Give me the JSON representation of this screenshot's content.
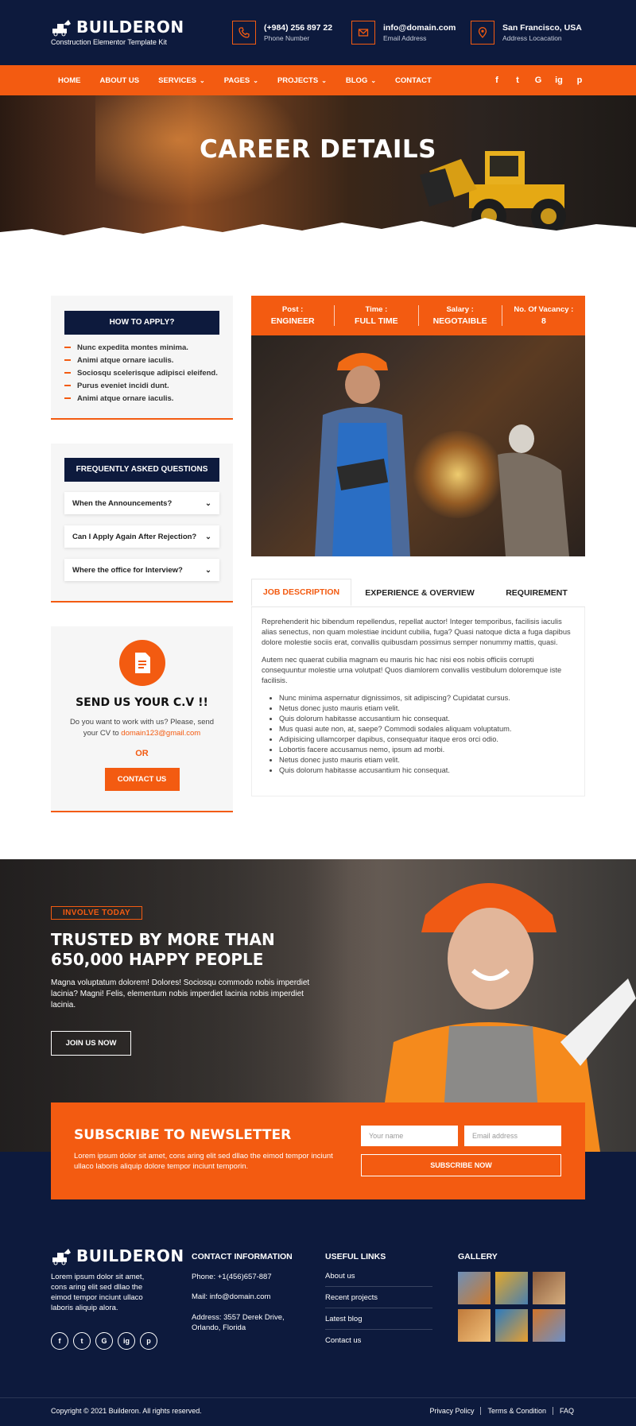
{
  "header": {
    "logo_name": "BUILDERON",
    "logo_tagline": "Construction Elementor Template Kit",
    "contacts": [
      {
        "icon": "phone-icon",
        "value": "(+984) 256 897 22",
        "label": "Phone Number"
      },
      {
        "icon": "mail-icon",
        "value": "info@domain.com",
        "label": "Email Address"
      },
      {
        "icon": "map-pin-icon",
        "value": "San Francisco, USA",
        "label": "Address Locacation"
      }
    ]
  },
  "nav": {
    "items": [
      "HOME",
      "ABOUT US",
      "SERVICES",
      "PAGES",
      "PROJECTS",
      "BLOG",
      "CONTACT"
    ],
    "social": [
      "f",
      "t",
      "G",
      "ig",
      "p"
    ]
  },
  "hero": {
    "title": "CAREER DETAILS"
  },
  "sidebar": {
    "apply_title": "HOW TO APPLY?",
    "apply_items": [
      "Nunc expedita montes minima.",
      "Animi atque ornare iaculis.",
      "Sociosqu scelerisque adipisci eleifend.",
      "Purus eveniet incidi dunt.",
      "Animi atque ornare iaculis."
    ],
    "faq_title": "FREQUENTLY ASKED QUESTIONS",
    "faq_items": [
      "When the Announcements?",
      "Can I Apply Again After Rejection?",
      "Where the office for Interview?"
    ],
    "cv_title": "SEND US YOUR C.V !!",
    "cv_text": "Do you want to work with us? Please, send your CV to",
    "cv_email": "domain123@gmail.com",
    "cv_or": "OR",
    "cv_button": "CONTACT US"
  },
  "job": {
    "meta": [
      {
        "label": "Post :",
        "value": "ENGINEER"
      },
      {
        "label": "Time :",
        "value": "FULL TIME"
      },
      {
        "label": "Salary :",
        "value": "NEGOTAIBLE"
      },
      {
        "label": "No. Of Vacancy :",
        "value": "8"
      }
    ],
    "tabs": [
      "JOB DESCRIPTION",
      "EXPERIENCE & OVERVIEW",
      "REQUIREMENT"
    ],
    "paragraph1": "Reprehenderit hic bibendum repellendus, repellat auctor! Integer temporibus, facilisis iaculis alias senectus, non quam molestiae incidunt cubilia, fuga? Quasi natoque dicta a fuga dapibus dolore molestie sociis erat, convallis quibusdam possimus semper nonummy mattis, quasi.",
    "paragraph2": "Autem nec quaerat cubilia magnam eu mauris hic hac nisi eos nobis officiis corrupti consequuntur molestie urna volutpat! Quos diamlorem convallis vestibulum doloremque iste facilisis.",
    "bullets": [
      "Nunc minima aspernatur dignissimos, sit adipiscing? Cupidatat cursus.",
      "Netus donec justo mauris etiam velit.",
      "Quis dolorum habitasse accusantium hic consequat.",
      "Mus quasi aute non, at, saepe? Commodi sodales aliquam voluptatum.",
      "Adipisicing ullamcorper dapibus, consequatur itaque eros orci odio.",
      "Lobortis facere accusamus nemo, ipsum ad morbi.",
      "Netus donec justo mauris etiam velit.",
      "Quis dolorum habitasse accusantium hic consequat."
    ]
  },
  "cta": {
    "badge": "INVOLVE TODAY",
    "title_line1": "TRUSTED BY MORE THAN",
    "title_line2": "650,000 HAPPY PEOPLE",
    "text": "Magna voluptatum dolorem! Dolores! Sociosqu commodo nobis imperdiet lacinia? Magni! Felis, elementum nobis imperdiet lacinia nobis imperdiet lacinia.",
    "button": "JOIN US NOW"
  },
  "newsletter": {
    "title": "SUBSCRIBE TO NEWSLETTER",
    "text": "Lorem ipsum dolor sit amet, cons aring elit sed dllao the eimod tempor inciunt ullaco laboris aliquip dolore tempor inciunt temporin.",
    "name_placeholder": "Your name",
    "email_placeholder": "Email address",
    "button": "SUBSCRIBE NOW"
  },
  "footer": {
    "logo_name": "BUILDERON",
    "about": "Lorem ipsum dolor sit amet, cons aring elit sed dllao the eimod tempor inciunt ullaco laboris aliquip alora.",
    "social": [
      "f",
      "t",
      "G",
      "ig",
      "p"
    ],
    "contact_title": "CONTACT INFORMATION",
    "phone": "Phone: +1(456)657-887",
    "mail": "Mail: info@domain.com",
    "address": "Address: 3557 Derek Drive, Orlando, Florida",
    "links_title": "USEFUL LINKS",
    "links": [
      "About us",
      "Recent projects",
      "Latest blog",
      "Contact us"
    ],
    "gallery_title": "GALLERY",
    "copyright": "Copyright © 2021 Builderon. All rights reserved.",
    "bottom_links": [
      "Privacy Policy",
      "Terms & Condition",
      "FAQ"
    ]
  },
  "colors": {
    "accent": "#f35b11",
    "navy": "#0d1a3d"
  }
}
